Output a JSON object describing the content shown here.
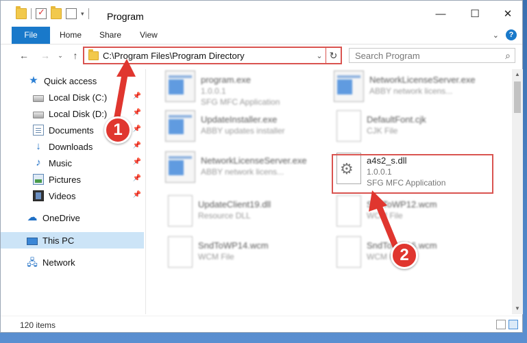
{
  "window": {
    "title": "Program"
  },
  "ribbon": {
    "tabs": [
      "File",
      "Home",
      "Share",
      "View"
    ]
  },
  "address": {
    "path": "C:\\Program Files\\Program Directory"
  },
  "search": {
    "placeholder": "Search Program"
  },
  "sidebar": {
    "items": [
      {
        "label": "Quick access",
        "icon": "star-icon"
      },
      {
        "label": "Local Disk (C:)",
        "icon": "disk-icon"
      },
      {
        "label": "Local Disk (D:)",
        "icon": "disk-icon"
      },
      {
        "label": "Documents",
        "icon": "documents-icon"
      },
      {
        "label": "Downloads",
        "icon": "download-icon"
      },
      {
        "label": "Music",
        "icon": "music-icon"
      },
      {
        "label": "Pictures",
        "icon": "pictures-icon"
      },
      {
        "label": "Videos",
        "icon": "videos-icon"
      },
      {
        "label": "OneDrive",
        "icon": "cloud-icon"
      },
      {
        "label": "This PC",
        "icon": "computer-icon"
      },
      {
        "label": "Network",
        "icon": "network-icon"
      }
    ]
  },
  "files": [
    {
      "name": "program.exe",
      "line1": "1.0.0.1",
      "line2": "SFG MFC Application"
    },
    {
      "name": "NetworkLicenseServer.exe",
      "line1": "ABBY network licens...",
      "line2": ""
    },
    {
      "name": "UpdateInstaller.exe",
      "line1": "ABBY updates installer",
      "line2": ""
    },
    {
      "name": "DefaultFont.cjk",
      "line1": "CJK File",
      "line2": ""
    },
    {
      "name": "NetworkLicenseServer.exe",
      "line1": "ABBY network licens...",
      "line2": ""
    },
    {
      "name": "a4s2_s.dll",
      "line1": "1.0.0.1",
      "line2": "SFG MFC Application"
    },
    {
      "name": "UpdateClient19.dll",
      "line1": "Resource DLL",
      "line2": ""
    },
    {
      "name": "SndToWP12.wcm",
      "line1": "WCM File",
      "line2": ""
    },
    {
      "name": "SndToWP14.wcm",
      "line1": "WCM File",
      "line2": ""
    },
    {
      "name": "SndToWP16.wcm",
      "line1": "WCM File",
      "line2": ""
    }
  ],
  "status": {
    "item_count": "120 items"
  },
  "annotations": {
    "step1": "1",
    "step2": "2"
  },
  "colors": {
    "accent": "#1979ca",
    "highlight": "#d9534f",
    "badge": "#e0362f",
    "selected": "#cce4f7"
  }
}
